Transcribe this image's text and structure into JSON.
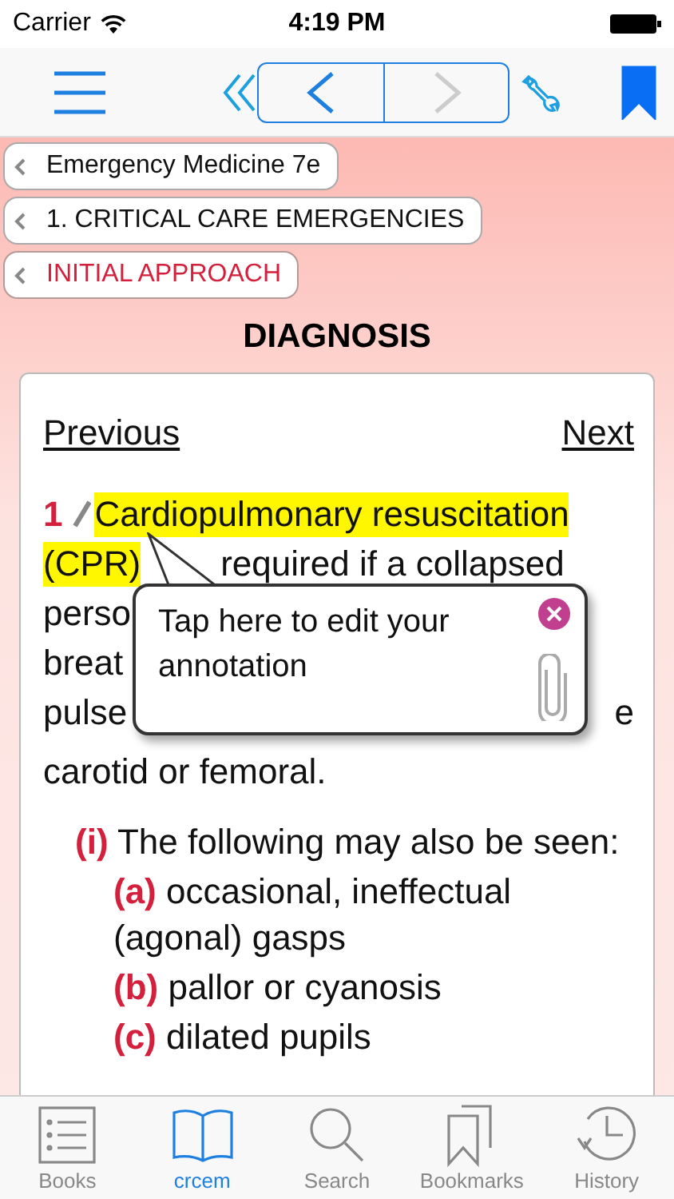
{
  "status_bar": {
    "carrier": "Carrier",
    "time": "4:19 PM"
  },
  "toolbar": {
    "back_enabled": true,
    "forward_enabled": false,
    "bookmarked": true
  },
  "breadcrumbs": [
    {
      "label": "Emergency Medicine 7e",
      "selected": false
    },
    {
      "label": "1. CRITICAL CARE EMERGENCIES",
      "selected": false
    },
    {
      "label": "INITIAL APPROACH",
      "selected": true
    }
  ],
  "heading": "DIAGNOSIS",
  "pager": {
    "previous": "Previous",
    "next": "Next"
  },
  "paragraph": {
    "number": "1",
    "annotated": true,
    "lines": [
      {
        "highlight": "Cardiopulmonary resuscitation"
      },
      {
        "highlight": "(CPR)",
        "text": "required if a collapsed"
      },
      {
        "text": "perso"
      },
      {
        "text": "breat"
      },
      {
        "text": "pulse",
        "end": "e"
      },
      {
        "text": "carotid or femoral."
      }
    ]
  },
  "popup": {
    "text": "Tap here to edit your annotation"
  },
  "list": [
    {
      "marker": "(i)",
      "text": "The following may also be seen:",
      "children": [
        {
          "marker": "(a)",
          "text": "occasional, ineffectual (agonal) gasps"
        },
        {
          "marker": "(b)",
          "text": "pallor or cyanosis"
        },
        {
          "marker": "(c)",
          "text": "dilated pupils"
        }
      ]
    }
  ],
  "tabs": [
    {
      "label": "Books",
      "kind": "list",
      "selected": false
    },
    {
      "label": "crcem",
      "kind": "book",
      "selected": true
    },
    {
      "label": "Search",
      "kind": "search",
      "selected": false
    },
    {
      "label": "Bookmarks",
      "kind": "bookmarks",
      "selected": false
    },
    {
      "label": "History",
      "kind": "history",
      "selected": false
    }
  ]
}
